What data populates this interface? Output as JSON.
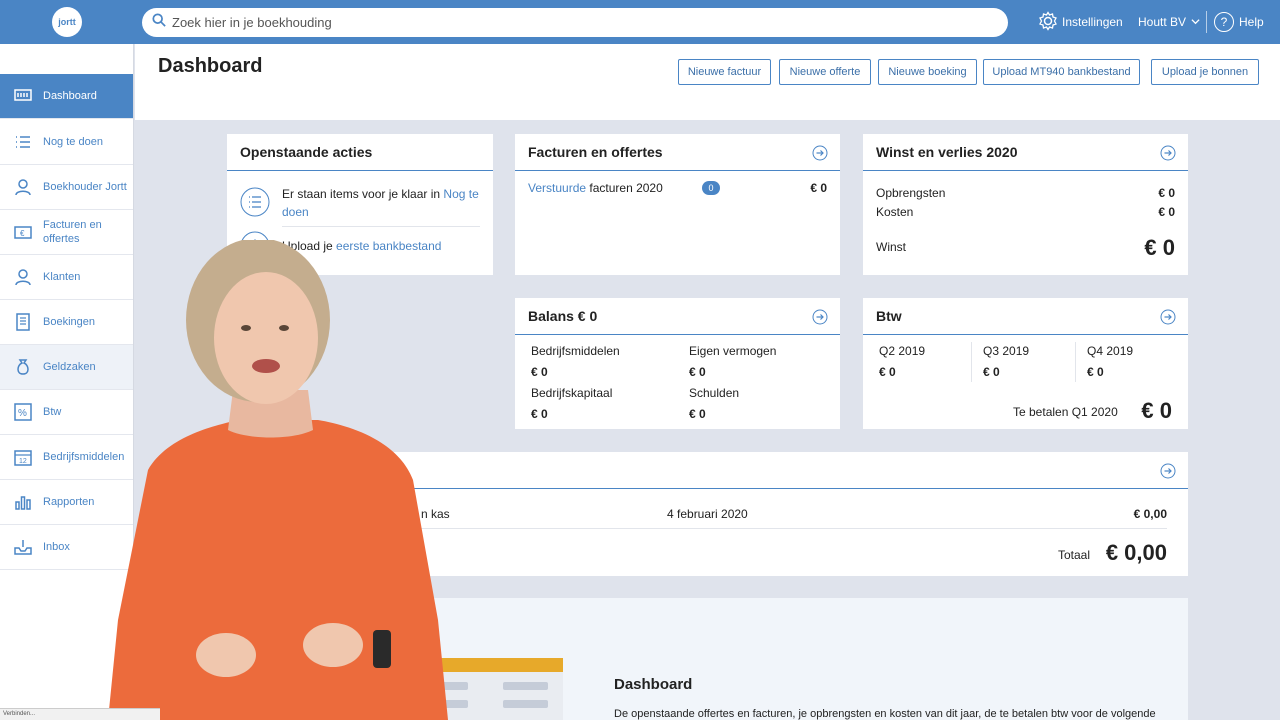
{
  "topbar": {
    "logo_text": "jortt",
    "search_placeholder": "Zoek hier in je boekhouding",
    "settings_label": "Instellingen",
    "company_label": "Houtt BV",
    "help_label": "Help"
  },
  "sidebar": {
    "items": [
      {
        "label": "Dashboard",
        "icon": "dashboard-icon"
      },
      {
        "label": "Nog te doen",
        "icon": "list-icon"
      },
      {
        "label": "Boekhouder Jortt",
        "icon": "accountant-icon"
      },
      {
        "label": "Facturen en offertes",
        "icon": "invoice-icon"
      },
      {
        "label": "Klanten",
        "icon": "customer-icon"
      },
      {
        "label": "Boekingen",
        "icon": "bookings-icon"
      },
      {
        "label": "Geldzaken",
        "icon": "money-bag-icon"
      },
      {
        "label": "Btw",
        "icon": "percent-icon"
      },
      {
        "label": "Bedrijfsmiddelen",
        "icon": "calendar-icon"
      },
      {
        "label": "Rapporten",
        "icon": "bar-chart-icon"
      },
      {
        "label": "Inbox",
        "icon": "inbox-icon"
      }
    ]
  },
  "header": {
    "title": "Dashboard",
    "buttons": [
      "Nieuwe factuur",
      "Nieuwe offerte",
      "Nieuwe boeking",
      "Upload MT940 bankbestand",
      "Upload je bonnen"
    ]
  },
  "acties": {
    "title": "Openstaande acties",
    "item1_pre": "Er staan items voor je klaar in ",
    "item1_link": "Nog te doen",
    "item2_pre": "Upload je ",
    "item2_link": "eerste bankbestand"
  },
  "facturen": {
    "title": "Facturen en offertes",
    "row_link": "Verstuurde",
    "row_rest": " facturen 2020",
    "badge": "0",
    "amount": "€ 0"
  },
  "winst": {
    "title": "Winst en verlies 2020",
    "opbrengsten_label": "Opbrengsten",
    "opbrengsten_value": "€ 0",
    "kosten_label": "Kosten",
    "kosten_value": "€ 0",
    "winst_label": "Winst",
    "winst_value": "€ 0"
  },
  "balans": {
    "title": "Balans € 0",
    "bedrijfsmiddelen_label": "Bedrijfsmiddelen",
    "bedrijfsmiddelen_value": "€ 0",
    "eigen_vermogen_label": "Eigen vermogen",
    "eigen_vermogen_value": "€ 0",
    "bedrijfskapitaal_label": "Bedrijfskapitaal",
    "bedrijfskapitaal_value": "€ 0",
    "schulden_label": "Schulden",
    "schulden_value": "€ 0"
  },
  "btw": {
    "title": "Btw",
    "quarters": [
      {
        "label": "Q2 2019",
        "value": "€ 0"
      },
      {
        "label": "Q3 2019",
        "value": "€ 0"
      },
      {
        "label": "Q4 2019",
        "value": "€ 0"
      }
    ],
    "te_betalen_label": "Te betalen Q1 2020",
    "te_betalen_value": "€ 0"
  },
  "geld": {
    "row_label": "n kas",
    "row_date": "4 februari 2020",
    "row_amount": "€ 0,00",
    "totaal_label": "Totaal",
    "totaal_value": "€ 0,00"
  },
  "info": {
    "title": "Dashboard",
    "text": "De openstaande offertes en facturen, je opbrengsten en kosten van dit jaar, de te betalen btw voor de volgende"
  },
  "status": "Verbinden..."
}
